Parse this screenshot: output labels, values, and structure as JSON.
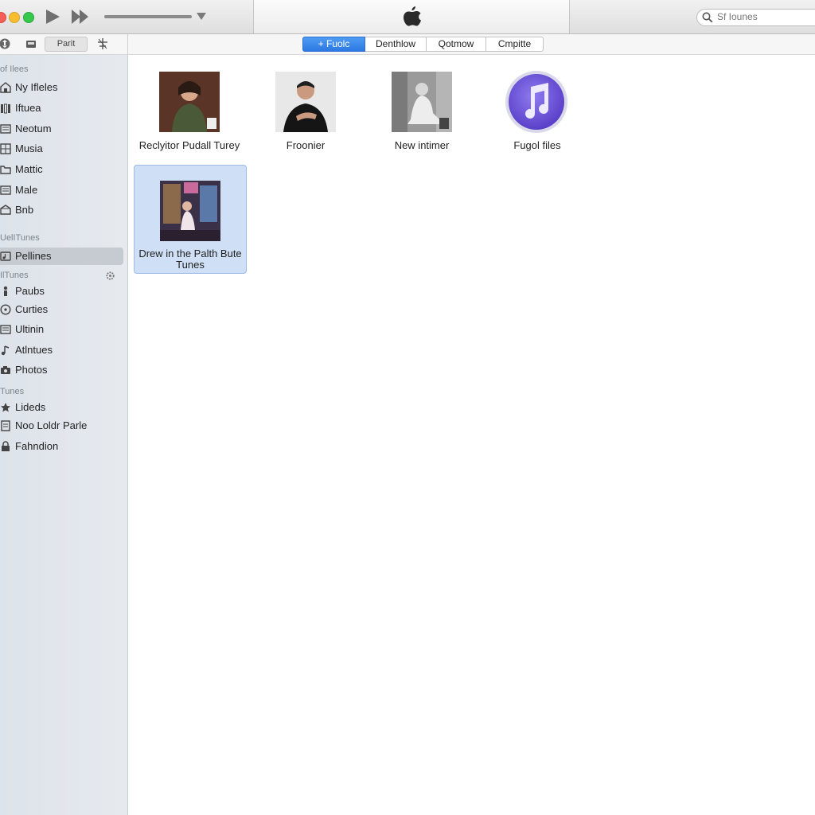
{
  "window": {
    "search_placeholder": "Sf Iounes"
  },
  "toolbar": {
    "part_button": "Parit",
    "segments": [
      {
        "label": "+ Fuolc",
        "active": true
      },
      {
        "label": "Denthlow",
        "active": false
      },
      {
        "label": "Qotmow",
        "active": false
      },
      {
        "label": "Cmpitte",
        "active": false
      }
    ]
  },
  "sidebar": {
    "section1": "of Ilees",
    "items1": [
      {
        "label": "Ny Ifleles",
        "icon": "library-icon"
      },
      {
        "label": "Iftuea",
        "icon": "shelf-icon"
      },
      {
        "label": "Neotum",
        "icon": "list-icon"
      },
      {
        "label": "Musia",
        "icon": "grid-icon"
      },
      {
        "label": "Mattic",
        "icon": "folder-icon"
      },
      {
        "label": "Male",
        "icon": "list-icon"
      },
      {
        "label": "Bnb",
        "icon": "box-icon"
      }
    ],
    "section2": "UelITunes",
    "selected_item": {
      "label": "Pellines",
      "icon": "playlist-icon"
    },
    "section3": "IlTunes",
    "items3": [
      {
        "label": "Paubs",
        "icon": "person-icon"
      },
      {
        "label": "Curties",
        "icon": "disc-icon"
      },
      {
        "label": "Ultinin",
        "icon": "list-icon"
      },
      {
        "label": "Atlntues",
        "icon": "note-icon"
      },
      {
        "label": "Photos",
        "icon": "camera-icon"
      }
    ],
    "section4": "Tunes",
    "items4": [
      {
        "label": "Lideds",
        "icon": "star-icon"
      },
      {
        "label": "Noo Loldr Parle",
        "icon": "doc-icon"
      },
      {
        "label": "Fahndion",
        "icon": "lock-icon"
      }
    ]
  },
  "content": {
    "tiles": [
      {
        "caption": "Reclyitor Pudall Turey"
      },
      {
        "caption": "Froonier"
      },
      {
        "caption": "New intimer"
      },
      {
        "caption": "Fugol files"
      },
      {
        "caption": "Drew in the Palth Bute Tunes",
        "selected": true
      }
    ]
  }
}
